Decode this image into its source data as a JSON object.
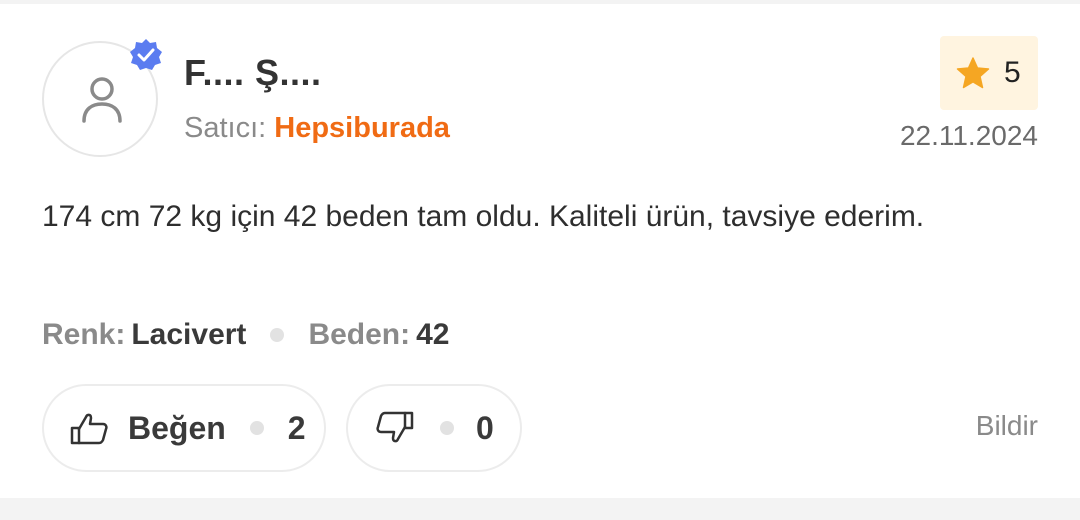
{
  "review": {
    "username": "F.... Ş....",
    "verified_icon": "verified-badge-icon",
    "seller_label": "Satıcı:",
    "seller_name": "Hepsiburada",
    "rating": "5",
    "rating_icon": "star-icon",
    "date": "22.11.2024",
    "text": "174 cm 72 kg için 42 beden tam oldu. Kaliteli ürün, tavsiye ederim.",
    "attributes": [
      {
        "label": "Renk:",
        "value": "Lacivert"
      },
      {
        "label": "Beden:",
        "value": "42"
      }
    ]
  },
  "actions": {
    "like_label": "Beğen",
    "like_count": "2",
    "dislike_count": "0",
    "report_label": "Bildir"
  },
  "colors": {
    "accent": "#f06b14",
    "verified": "#5b7cf0",
    "star": "#f5a623",
    "rating_bg": "#fff4e0"
  }
}
